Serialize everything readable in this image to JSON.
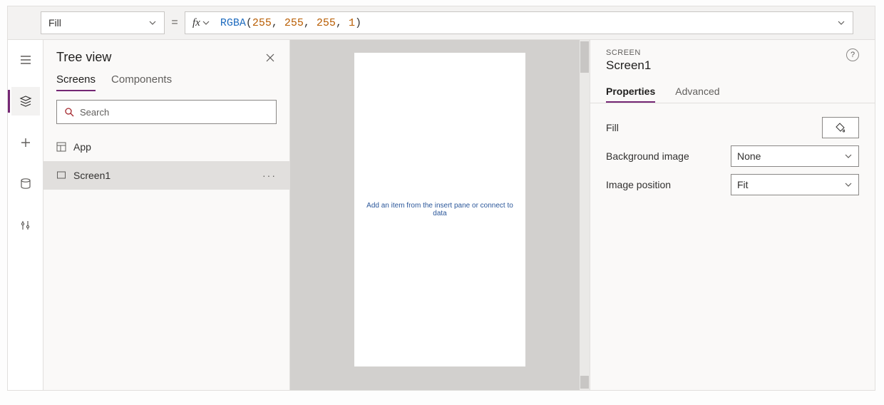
{
  "formula_bar": {
    "property": "Fill",
    "fn": "RGBA",
    "args": [
      "255",
      "255",
      "255",
      "1"
    ]
  },
  "tree": {
    "title": "Tree view",
    "tabs": {
      "screens": "Screens",
      "components": "Components"
    },
    "search_placeholder": "Search",
    "items": [
      {
        "label": "App"
      },
      {
        "label": "Screen1"
      }
    ]
  },
  "canvas": {
    "hint": "Add an item from the insert pane or connect to data"
  },
  "props": {
    "kicker": "SCREEN",
    "title": "Screen1",
    "tabs": {
      "properties": "Properties",
      "advanced": "Advanced"
    },
    "rows": {
      "fill": "Fill",
      "bg_image": "Background image",
      "bg_image_value": "None",
      "img_pos": "Image position",
      "img_pos_value": "Fit"
    }
  }
}
